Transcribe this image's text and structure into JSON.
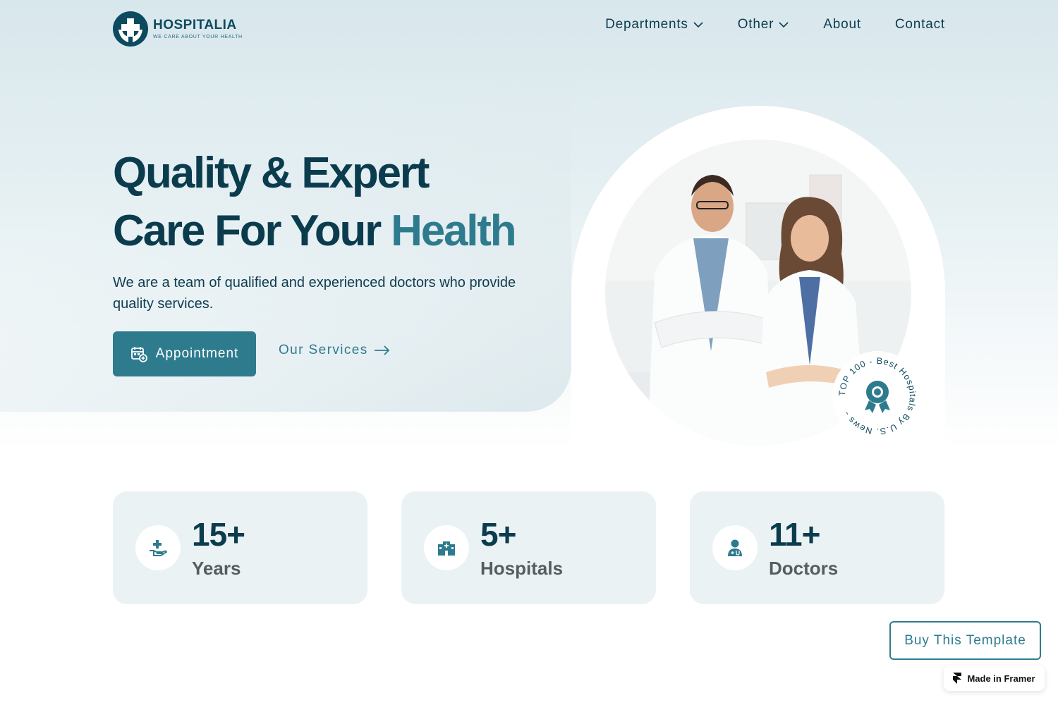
{
  "brand": {
    "name": "HOSPITALIA",
    "tagline": "WE CARE ABOUT YOUR HEALTH",
    "primary_color": "#2e7b8e",
    "dark_color": "#0b3c4e"
  },
  "nav": {
    "items": [
      {
        "label": "Departments",
        "has_dropdown": true
      },
      {
        "label": "Other",
        "has_dropdown": true
      },
      {
        "label": "About",
        "has_dropdown": false
      },
      {
        "label": "Contact",
        "has_dropdown": false
      }
    ]
  },
  "hero": {
    "title_line1": "Quality & Expert",
    "title_line2": "Care For Your",
    "title_accent": "Health",
    "subtitle": "We are a team of qualified and experienced doctors who provide quality services.",
    "appointment_label": "Appointment",
    "services_label": "Our Services",
    "badge_text": "TOP 100 - Best Hospitals By U.S. News -"
  },
  "stats": [
    {
      "value": "15+",
      "label": "Years",
      "icon": "hand-plus-icon"
    },
    {
      "value": "5+",
      "label": "Hospitals",
      "icon": "hospital-icon"
    },
    {
      "value": "11+",
      "label": "Doctors",
      "icon": "doctor-icon"
    }
  ],
  "floating": {
    "buy_label": "Buy This Template",
    "framer_label": "Made in Framer"
  }
}
